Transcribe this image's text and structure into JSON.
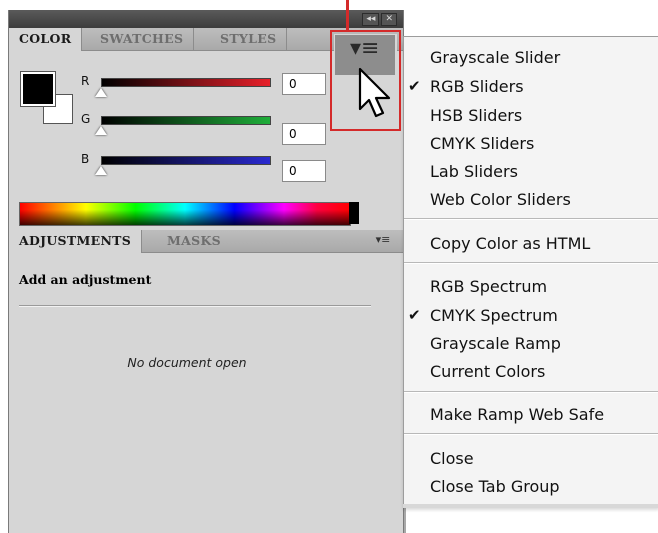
{
  "color_panel": {
    "tabs": [
      "COLOR",
      "SWATCHES",
      "STYLES"
    ],
    "active_tab": "COLOR",
    "sliders": [
      {
        "label": "R",
        "value": "0"
      },
      {
        "label": "G",
        "value": "0"
      },
      {
        "label": "B",
        "value": "0"
      }
    ],
    "foreground_color": "#000000",
    "background_color": "#ffffff",
    "menu_icon": "panel-menu-icon"
  },
  "adjustments_panel": {
    "tabs": [
      "ADJUSTMENTS",
      "MASKS"
    ],
    "active_tab": "ADJUSTMENTS",
    "heading": "Add an adjustment",
    "empty_message": "No document open",
    "menu_icon": "panel-menu-icon"
  },
  "flyout_menu": {
    "groups": [
      [
        {
          "label": "Grayscale Slider",
          "checked": false
        },
        {
          "label": "RGB Sliders",
          "checked": true
        },
        {
          "label": "HSB Sliders",
          "checked": false
        },
        {
          "label": "CMYK Sliders",
          "checked": false
        },
        {
          "label": "Lab Sliders",
          "checked": false
        },
        {
          "label": "Web Color Sliders",
          "checked": false
        }
      ],
      [
        {
          "label": "Copy Color as HTML",
          "checked": false
        }
      ],
      [
        {
          "label": "RGB Spectrum",
          "checked": false
        },
        {
          "label": "CMYK Spectrum",
          "checked": true
        },
        {
          "label": "Grayscale Ramp",
          "checked": false
        },
        {
          "label": "Current Colors",
          "checked": false
        }
      ],
      [
        {
          "label": "Make Ramp Web Safe",
          "checked": false
        }
      ],
      [
        {
          "label": "Close",
          "checked": false
        },
        {
          "label": "Close Tab Group",
          "checked": false
        }
      ]
    ]
  },
  "icons": {
    "check": "checkmark-icon",
    "cursor": "arrow-cursor-icon",
    "collapse": "collapse-icon",
    "close": "close-icon"
  },
  "colors": {
    "highlight": "#d42a2a",
    "red_track": "#e8202a",
    "green_track": "#1fae3a",
    "blue_track": "#2a2ad0"
  }
}
